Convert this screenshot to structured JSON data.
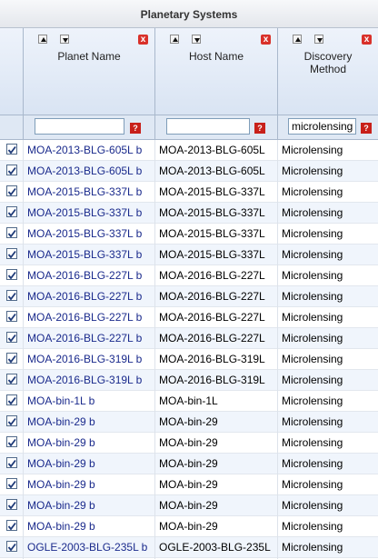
{
  "title": "Planetary Systems",
  "columns": [
    {
      "label": "Planet Name"
    },
    {
      "label": "Host Name"
    },
    {
      "label": "Discovery Method"
    }
  ],
  "filters": [
    "",
    "",
    "microlensing"
  ],
  "help_glyph": "?",
  "close_glyph": "x",
  "rows": [
    {
      "planet": "MOA-2013-BLG-605L b",
      "host": "MOA-2013-BLG-605L",
      "method": "Microlensing"
    },
    {
      "planet": "MOA-2013-BLG-605L b",
      "host": "MOA-2013-BLG-605L",
      "method": "Microlensing"
    },
    {
      "planet": "MOA-2015-BLG-337L b",
      "host": "MOA-2015-BLG-337L",
      "method": "Microlensing"
    },
    {
      "planet": "MOA-2015-BLG-337L b",
      "host": "MOA-2015-BLG-337L",
      "method": "Microlensing"
    },
    {
      "planet": "MOA-2015-BLG-337L b",
      "host": "MOA-2015-BLG-337L",
      "method": "Microlensing"
    },
    {
      "planet": "MOA-2015-BLG-337L b",
      "host": "MOA-2015-BLG-337L",
      "method": "Microlensing"
    },
    {
      "planet": "MOA-2016-BLG-227L b",
      "host": "MOA-2016-BLG-227L",
      "method": "Microlensing"
    },
    {
      "planet": "MOA-2016-BLG-227L b",
      "host": "MOA-2016-BLG-227L",
      "method": "Microlensing"
    },
    {
      "planet": "MOA-2016-BLG-227L b",
      "host": "MOA-2016-BLG-227L",
      "method": "Microlensing"
    },
    {
      "planet": "MOA-2016-BLG-227L b",
      "host": "MOA-2016-BLG-227L",
      "method": "Microlensing"
    },
    {
      "planet": "MOA-2016-BLG-319L b",
      "host": "MOA-2016-BLG-319L",
      "method": "Microlensing"
    },
    {
      "planet": "MOA-2016-BLG-319L b",
      "host": "MOA-2016-BLG-319L",
      "method": "Microlensing"
    },
    {
      "planet": "MOA-bin-1L b",
      "host": "MOA-bin-1L",
      "method": "Microlensing"
    },
    {
      "planet": "MOA-bin-29 b",
      "host": "MOA-bin-29",
      "method": "Microlensing"
    },
    {
      "planet": "MOA-bin-29 b",
      "host": "MOA-bin-29",
      "method": "Microlensing"
    },
    {
      "planet": "MOA-bin-29 b",
      "host": "MOA-bin-29",
      "method": "Microlensing"
    },
    {
      "planet": "MOA-bin-29 b",
      "host": "MOA-bin-29",
      "method": "Microlensing"
    },
    {
      "planet": "MOA-bin-29 b",
      "host": "MOA-bin-29",
      "method": "Microlensing"
    },
    {
      "planet": "MOA-bin-29 b",
      "host": "MOA-bin-29",
      "method": "Microlensing"
    },
    {
      "planet": "OGLE-2003-BLG-235L b",
      "host": "OGLE-2003-BLG-235L",
      "method": "Microlensing"
    }
  ]
}
